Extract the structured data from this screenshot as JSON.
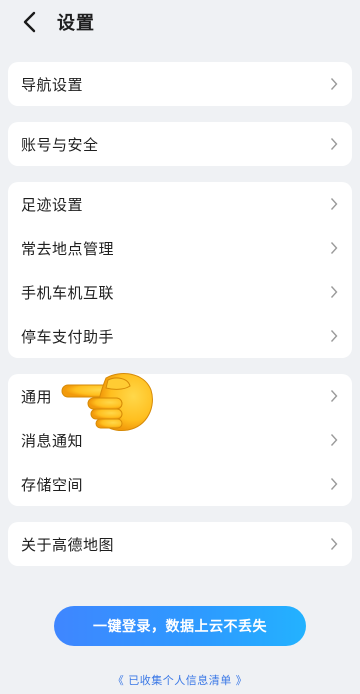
{
  "header": {
    "title": "设置",
    "back_icon": "chevron-left-icon"
  },
  "groups": [
    {
      "items": [
        {
          "label": "导航设置"
        }
      ]
    },
    {
      "items": [
        {
          "label": "账号与安全"
        }
      ]
    },
    {
      "items": [
        {
          "label": "足迹设置"
        },
        {
          "label": "常去地点管理"
        },
        {
          "label": "手机车机互联"
        },
        {
          "label": "停车支付助手"
        }
      ]
    },
    {
      "items": [
        {
          "label": "通用"
        },
        {
          "label": "消息通知"
        },
        {
          "label": "存储空间"
        }
      ]
    },
    {
      "items": [
        {
          "label": "关于高德地图"
        }
      ]
    }
  ],
  "login_button": {
    "label": "一键登录，数据上云不丢失"
  },
  "info_link": {
    "label": "《 已收集个人信息清单 》"
  },
  "overlay": {
    "icon": "pointing-hand-icon"
  },
  "colors": {
    "background": "#eff1f4",
    "accent": "#2d8cff",
    "link": "#3a78e6"
  }
}
